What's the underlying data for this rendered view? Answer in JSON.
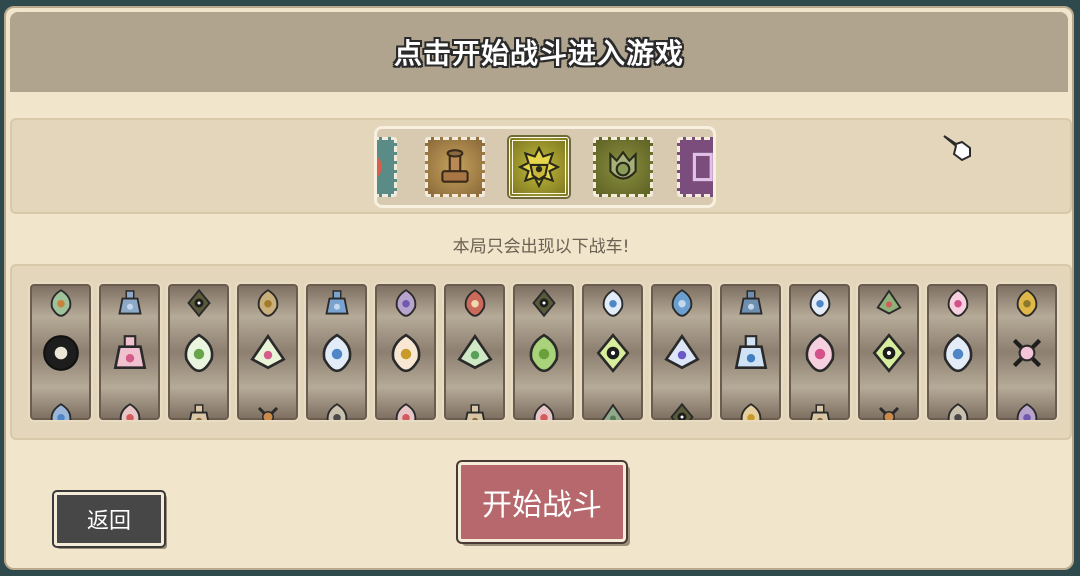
{
  "header": {
    "title": "点击开始战斗进入游戏"
  },
  "selector": {
    "stamps": [
      {
        "name": "partial-left-stamp",
        "bg": "#5a8b86"
      },
      {
        "name": "cannon-stamp",
        "bg": "#8c6a3a"
      },
      {
        "name": "sun-shield-stamp",
        "bg": "#7f7a22"
      },
      {
        "name": "horned-shield-stamp",
        "bg": "#6c7028"
      },
      {
        "name": "partial-right-stamp",
        "bg": "#7a4d7d"
      }
    ],
    "selected_index": 2
  },
  "hint": "本局只会出现以下战车!",
  "roster": {
    "reels": [
      {
        "mid": "black-ring",
        "top": "shell",
        "bot": "blue-shell"
      },
      {
        "mid": "pink-flask",
        "top": "castle",
        "bot": "red-cross"
      },
      {
        "mid": "green-gem",
        "top": "dark-ring",
        "bot": "vase"
      },
      {
        "mid": "triangle-spiral",
        "top": "star",
        "bot": "bone"
      },
      {
        "mid": "blue-gear",
        "top": "flask-blue",
        "bot": "dark-bone"
      },
      {
        "mid": "leaf-drop",
        "top": "purple-orb",
        "bot": "red-cross"
      },
      {
        "mid": "green-diamond",
        "top": "mushroom",
        "bot": "vase"
      },
      {
        "mid": "green-pearl",
        "top": "dark-ring",
        "bot": "red-cross"
      },
      {
        "mid": "green-eye",
        "top": "blue-gear",
        "bot": "green-tri"
      },
      {
        "mid": "blue-diamond",
        "top": "blue-bird",
        "bot": "dark-ring"
      },
      {
        "mid": "blue-flask",
        "top": "blue-castle",
        "bot": "leaf"
      },
      {
        "mid": "pink-drop",
        "top": "blue-drop",
        "bot": "vase"
      },
      {
        "mid": "green-eye",
        "top": "red-cross-diamond",
        "bot": "bone"
      },
      {
        "mid": "blue-drop",
        "top": "pink-drop",
        "bot": "dark-hand"
      },
      {
        "mid": "crossbones",
        "top": "gold-crown",
        "bot": "purple-orb"
      }
    ]
  },
  "buttons": {
    "back": "返回",
    "start": "开始战斗"
  }
}
